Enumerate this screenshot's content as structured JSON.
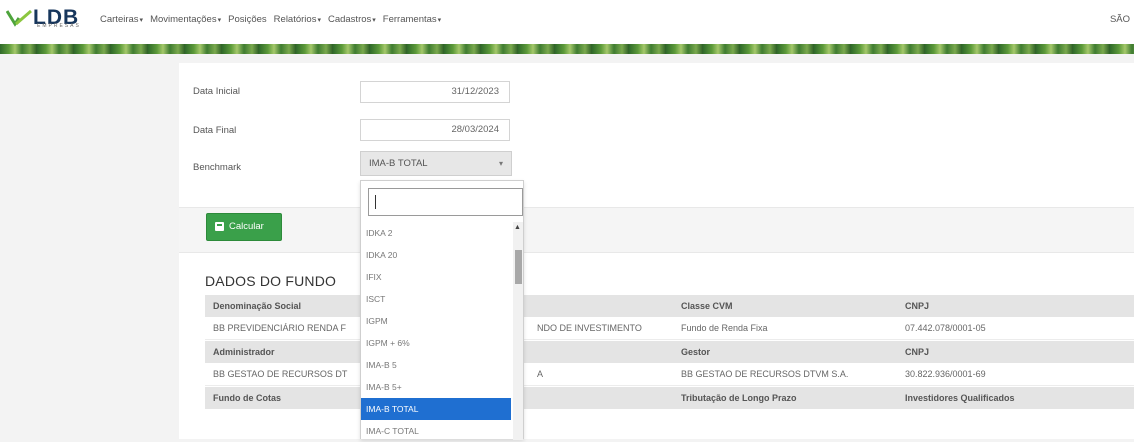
{
  "logo": {
    "text": "LDB",
    "subtext": "EMPRESAS"
  },
  "nav": {
    "items": [
      "Carteiras",
      "Movimentações",
      "Posições",
      "Relatórios",
      "Cadastros",
      "Ferramentas"
    ],
    "right": "SÃO"
  },
  "form": {
    "data_inicial_label": "Data Inicial",
    "data_inicial_value": "31/12/2023",
    "data_final_label": "Data Final",
    "data_final_value": "28/03/2024",
    "benchmark_label": "Benchmark",
    "benchmark_value": "IMA-B TOTAL"
  },
  "calc_button": "Calcular",
  "section_title": "DADOS DO FUNDO",
  "table": {
    "rows": [
      {
        "type": "head",
        "c1": "Denominação Social",
        "c2": "",
        "c3": "Classe CVM",
        "c4": "CNPJ"
      },
      {
        "type": "body",
        "c1": "BB PREVIDENCIÁRIO RENDA F",
        "c2": "NDO DE INVESTIMENTO",
        "c3": "Fundo de Renda Fixa",
        "c4": "07.442.078/0001-05"
      },
      {
        "type": "head",
        "c1": "Administrador",
        "c2": "",
        "c3": "Gestor",
        "c4": "CNPJ"
      },
      {
        "type": "body",
        "c1": "BB GESTAO DE RECURSOS DT",
        "c2": "A",
        "c3": "BB GESTAO DE RECURSOS DTVM S.A.",
        "c4": "30.822.936/0001-69"
      },
      {
        "type": "head",
        "c1": "Fundo de Cotas",
        "c2": "",
        "c3": "Tributação de Longo Prazo",
        "c4": "Investidores Qualificados"
      }
    ]
  },
  "dropdown": {
    "search_value": "",
    "options": [
      "IDKA 2",
      "IDKA 20",
      "IFIX",
      "ISCT",
      "IGPM",
      "IGPM + 6%",
      "IMA-B 5",
      "IMA-B 5+",
      "IMA-B TOTAL",
      "IMA-C TOTAL"
    ],
    "selected": "IMA-B TOTAL",
    "selected_color": "#1f6fd1"
  },
  "colors": {
    "brand_green": "#3aa04a",
    "brand_navy": "#17365c"
  }
}
